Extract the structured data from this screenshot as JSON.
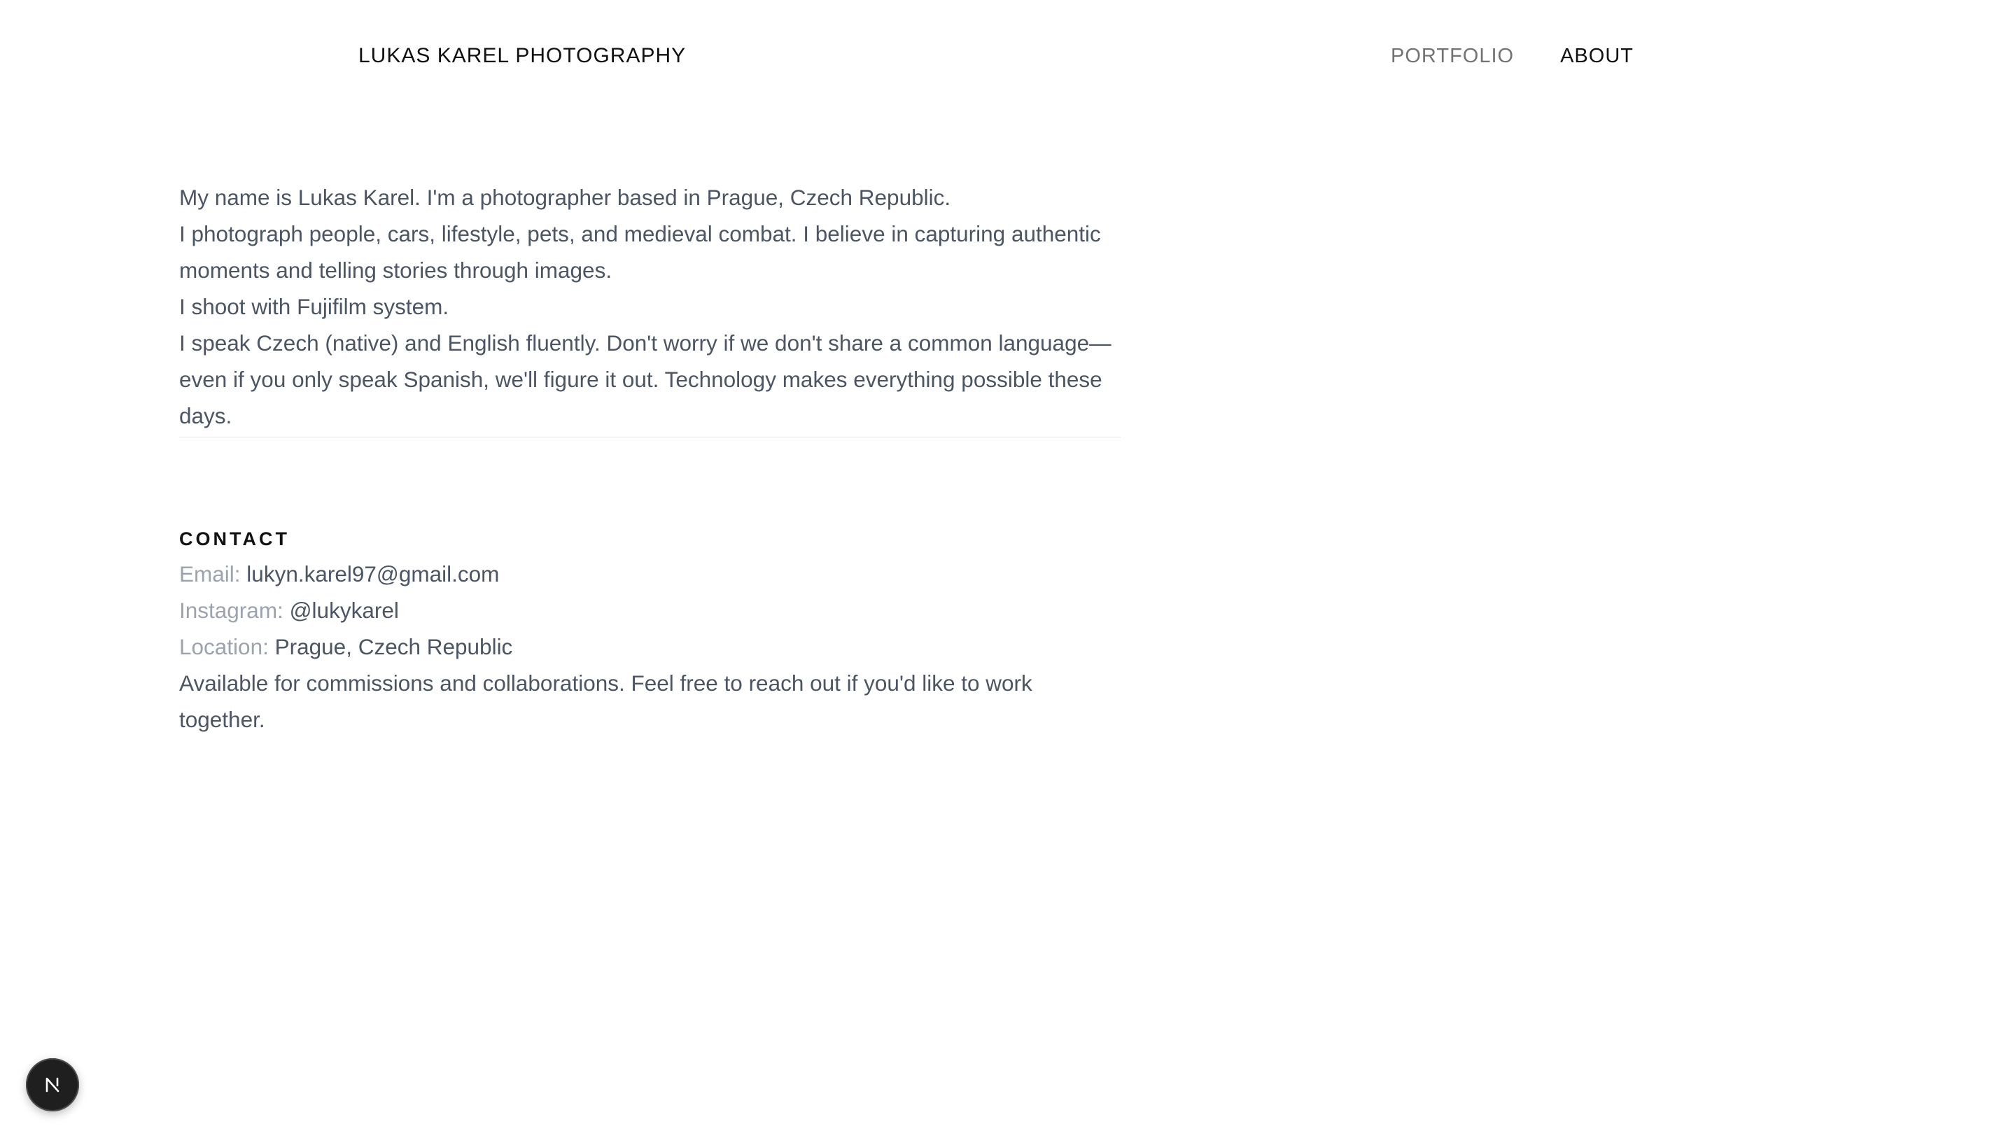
{
  "header": {
    "site_title": "LUKAS KAREL PHOTOGRAPHY",
    "nav": [
      {
        "label": "PORTFOLIO",
        "active": false
      },
      {
        "label": "ABOUT",
        "active": true
      }
    ]
  },
  "bio": {
    "paragraphs": [
      "My name is Lukas Karel. I'm a photographer based in Prague, Czech Republic.",
      "I photograph people, cars, lifestyle, pets, and medieval combat. I believe in capturing authentic moments and telling stories through images.",
      "I shoot with Fujifilm system.",
      "I speak Czech (native) and English fluently. Don't worry if we don't share a common language—even if you only speak Spanish, we'll figure it out. Technology makes everything possible these days."
    ]
  },
  "contact": {
    "heading": "CONTACT",
    "email_label": "Email:",
    "email_value": "lukyn.karel97@gmail.com",
    "instagram_label": "Instagram:",
    "instagram_value": "@lukykarel",
    "location_label": "Location:",
    "location_value": "Prague, Czech Republic",
    "note": "Available for commissions and collaborations. Feel free to reach out if you'd like to work together."
  },
  "dev_badge": {
    "icon": "nextjs-logo-icon"
  },
  "colors": {
    "text_primary": "#111111",
    "text_body": "#4b5563",
    "text_muted": "#9ca3af",
    "nav_inactive": "#737373",
    "divider": "#e5e7eb",
    "badge_bg": "#1f1f1f"
  }
}
